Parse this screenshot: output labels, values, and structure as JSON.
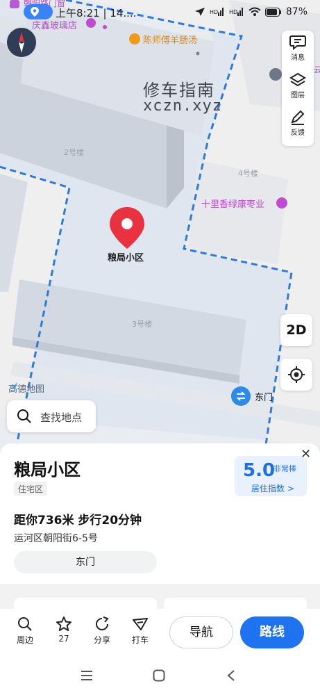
{
  "status_bar": {
    "time": "上午8:21 | 14....",
    "battery": "87%"
  },
  "map": {
    "poi_top_road": "朝阳路门窗",
    "poi_glass_shop": "庆鑫玻璃店",
    "poi_restaurant": "陈师傅羊肠汤",
    "poi_store": "十里香绿康枣业",
    "building_2": "2号楼",
    "building_3": "3号楼",
    "building_4": "4号楼",
    "marker_label": "粮局小区",
    "gate_label": "东门",
    "edge_label": "云",
    "watermark_line1": "修车指南",
    "watermark_line2": "xczn.xyz",
    "amap_logo": "高德地图",
    "search_placeholder": "查找地点"
  },
  "side_toolbar": {
    "messages": "消息",
    "layers": "图层",
    "feedback": "反馈",
    "mode_2d": "2D"
  },
  "sheet": {
    "title": "粮局小区",
    "category": "住宅区",
    "score": "5.0",
    "score_level": "非常棒",
    "score_label": "居住指数 >",
    "distance": "距你736米  步行20分钟",
    "address": "运河区朝阳街6-5号",
    "gate": "东门"
  },
  "action_bar": {
    "nearby": "周边",
    "favorites": "27",
    "share": "分享",
    "taxi": "打车",
    "navigate": "导航",
    "route": "路线"
  },
  "colors": {
    "accent": "#1f72f0",
    "marker": "#e8323f",
    "boundary": "#2e7bd6"
  }
}
